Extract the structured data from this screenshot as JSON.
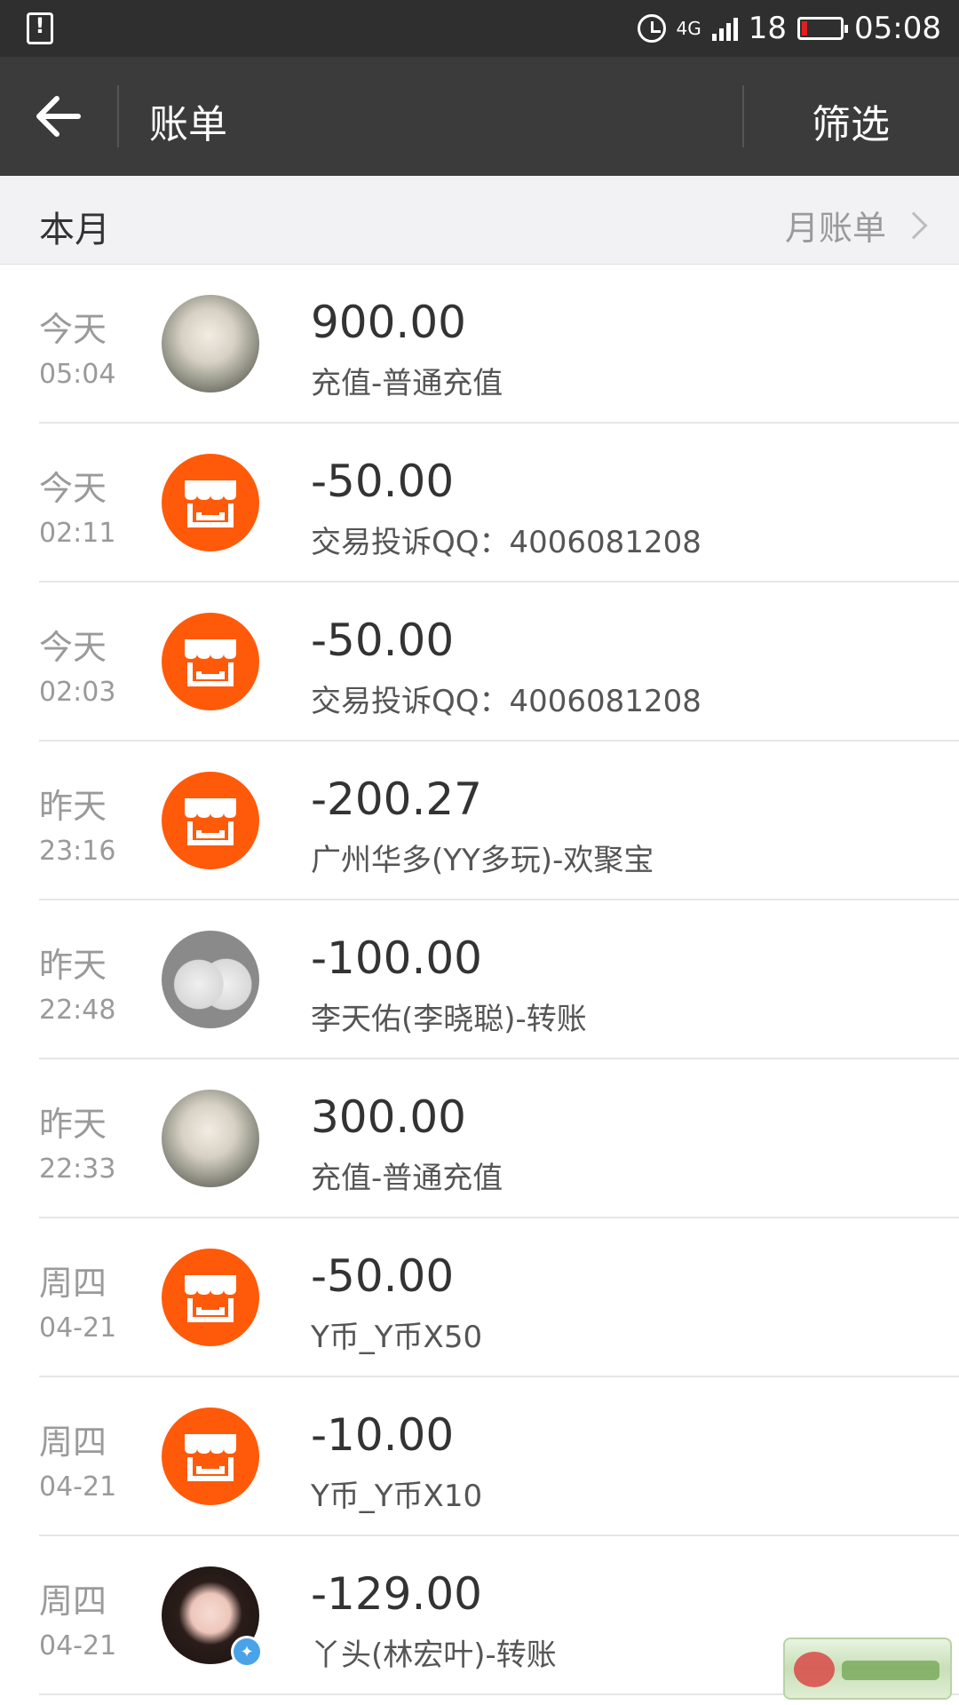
{
  "status_bar": {
    "network": "4G",
    "battery": "18",
    "time": "05:08"
  },
  "title_bar": {
    "title": "账单",
    "filter_label": "筛选"
  },
  "month_header": {
    "label": "本月",
    "monthly_bill_label": "月账单"
  },
  "transactions": [
    {
      "day": "今天",
      "time": "05:04",
      "amount": "900.00",
      "desc": "充值-普通充值",
      "avatar": "anime"
    },
    {
      "day": "今天",
      "time": "02:11",
      "amount": "-50.00",
      "desc": "交易投诉QQ：4006081208",
      "avatar": "shop"
    },
    {
      "day": "今天",
      "time": "02:03",
      "amount": "-50.00",
      "desc": "交易投诉QQ：4006081208",
      "avatar": "shop"
    },
    {
      "day": "昨天",
      "time": "23:16",
      "amount": "-200.27",
      "desc": "广州华多(YY多玩)-欢聚宝",
      "avatar": "shop"
    },
    {
      "day": "昨天",
      "time": "22:48",
      "amount": "-100.00",
      "desc": "李天佑(李晓聪)-转账",
      "avatar": "birds"
    },
    {
      "day": "昨天",
      "time": "22:33",
      "amount": "300.00",
      "desc": "充值-普通充值",
      "avatar": "anime"
    },
    {
      "day": "周四",
      "time": "04-21",
      "amount": "-50.00",
      "desc": "Y币_Y币X50",
      "avatar": "shop"
    },
    {
      "day": "周四",
      "time": "04-21",
      "amount": "-10.00",
      "desc": "Y币_Y币X10",
      "avatar": "shop"
    },
    {
      "day": "周四",
      "time": "04-21",
      "amount": "-129.00",
      "desc": "丫头(林宏叶)-转账",
      "avatar": "girl"
    }
  ],
  "colors": {
    "shop_orange": "#ff5a0a",
    "title_bar": "#3b3b3b",
    "status_bar": "#2f2f2f",
    "battery_low": "#e02020"
  }
}
